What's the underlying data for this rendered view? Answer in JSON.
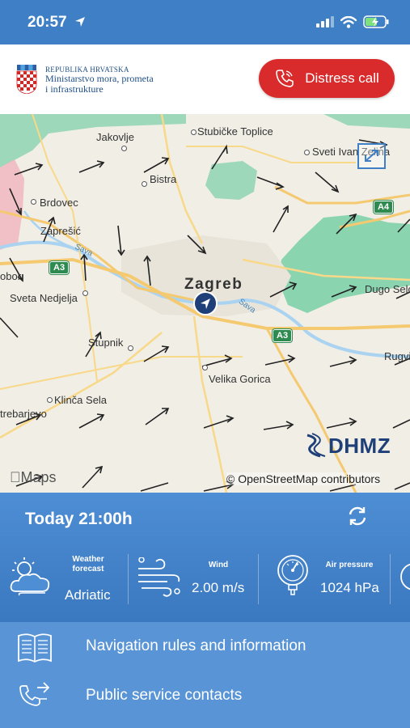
{
  "status_bar": {
    "time": "20:57"
  },
  "header": {
    "org_line1": "REPUBLIKA HRVATSKA",
    "org_line2": "Ministarstvo mora, prometa",
    "org_line3": "i infrastrukture",
    "distress_label": "Distress call"
  },
  "map": {
    "places": [
      "Jakovlje",
      "Stubičke Toplice",
      "Sveti Ivan Zelina",
      "Bistra",
      "Brdovec",
      "Zaprešić",
      "Sveta Nedjelja",
      "Zagreb",
      "Dugo Selo",
      "Stupnik",
      "Rugvi",
      "Velika Gorica",
      "Klinča Sela",
      "trebarjevo",
      "obor"
    ],
    "rivers": [
      "Sava",
      "Sava"
    ],
    "roads": [
      "A3",
      "A4",
      "A3"
    ],
    "brand_maps": "Maps",
    "attribution": "© OpenStreetMap contributors",
    "dhmz": "DHMZ"
  },
  "weather": {
    "title": "Today 21:00h",
    "forecast_head": "Weather\nforecast",
    "forecast_value": "Adriatic",
    "wind_head": "Wind",
    "wind_value": "2.00 m/s",
    "pressure_head": "Air pressure",
    "pressure_value": "1024 hPa"
  },
  "menu": {
    "items": [
      {
        "label": "Navigation rules and information"
      },
      {
        "label": "Public service contacts"
      }
    ]
  },
  "colors": {
    "accent": "#3e7fc5",
    "distress": "#d92b2b",
    "dhmz": "#1f3f78"
  }
}
